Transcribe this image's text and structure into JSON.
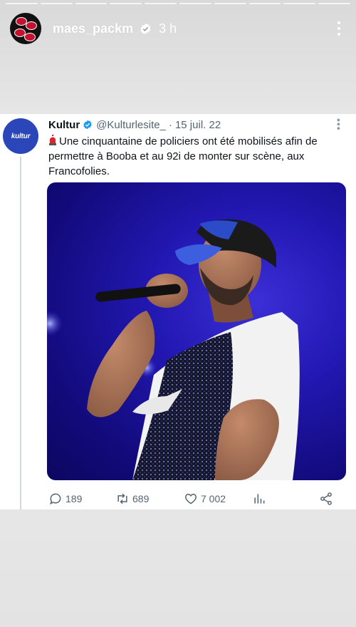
{
  "story": {
    "username": "maes_packm",
    "time": "3 h",
    "segments": 10
  },
  "tweet": {
    "name": "Kultur",
    "handle": "@Kulturlesite_",
    "separator": "·",
    "date": "15 juil. 22",
    "avatar_text": "kultur",
    "text": "Une cinquantaine de policiers ont été mobilisés afin de permettre à Booba et au 92i de monter sur scène, aux Francofolies.",
    "stats": {
      "replies": "189",
      "retweets": "689",
      "likes": "7 002"
    }
  },
  "colors": {
    "twitter_blue": "#1d9bf0",
    "kultur_blue": "#2a46b8",
    "stage_blue": "#2218b3",
    "instagram_red": "#c8102e"
  },
  "icons": {
    "verified": "verified-icon",
    "reply": "reply-icon",
    "retweet": "retweet-icon",
    "like": "heart-icon",
    "views": "analytics-icon",
    "share": "share-icon",
    "siren": "police-light-icon"
  }
}
